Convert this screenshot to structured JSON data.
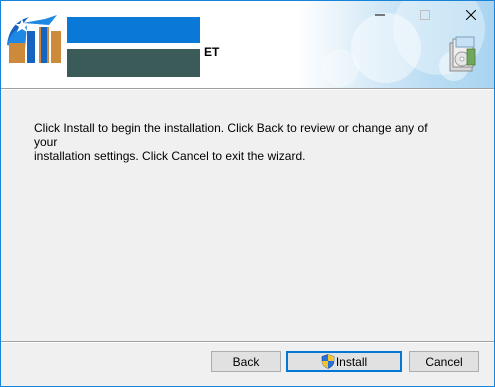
{
  "window": {
    "controls": {
      "minimize_icon": "minimize-icon",
      "maximize_icon": "maximize-icon",
      "close_icon": "close-icon"
    }
  },
  "banner": {
    "title_suffix": "ET",
    "logo_icon": "installer-logo-icon",
    "setup_icon": "setup-package-icon"
  },
  "main": {
    "message_line1": "Click Install to begin the installation. Click Back to review or change any of your",
    "message_line2": "installation settings. Click Cancel to exit the wizard."
  },
  "footer": {
    "back_label": "Back",
    "install_label": "Install",
    "cancel_label": "Cancel",
    "install_icon": "uac-shield-icon"
  },
  "colors": {
    "accent": "#0078d7",
    "logo_blue": "#0a78d7",
    "logo_dark": "#3b5b58",
    "window_bg": "#f0f0f0"
  }
}
